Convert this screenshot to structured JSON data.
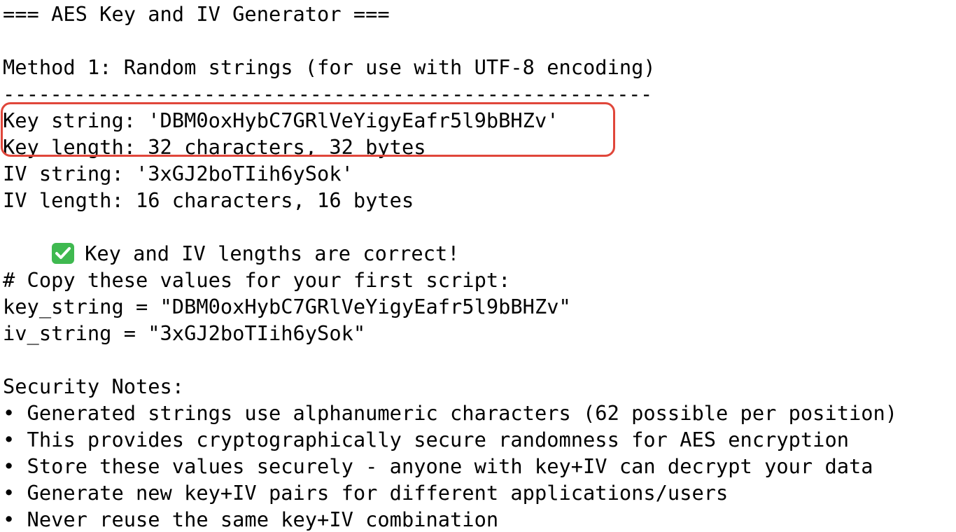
{
  "header": {
    "title": "=== AES Key and IV Generator ==="
  },
  "method1": {
    "heading": "Method 1: Random strings (for use with UTF-8 encoding)",
    "separator": "-------------------------------------------------------"
  },
  "key": {
    "string_line": "Key string: 'DBM0oxHybC7GRlVeYigyEafr5l9bBHZv'",
    "length_line": "Key length: 32 characters, 32 bytes"
  },
  "iv": {
    "string_line": "IV string: '3xGJ2boTIih6ySok'",
    "length_line": "IV length: 16 characters, 16 bytes"
  },
  "status": {
    "icon": "check-mark-icon",
    "icon_color": "#3fb950",
    "text": "Key and IV lengths are correct!"
  },
  "copy": {
    "comment": "# Copy these values for your first script:",
    "key_assign": "key_string = \"DBM0oxHybC7GRlVeYigyEafr5l9bBHZv\"",
    "iv_assign": "iv_string = \"3xGJ2boTIih6ySok\""
  },
  "security": {
    "heading": "Security Notes:",
    "notes": [
      "• Generated strings use alphanumeric characters (62 possible per position)",
      "• This provides cryptographically secure randomness for AES encryption",
      "• Store these values securely - anyone with key+IV can decrypt your data",
      "• Generate new key+IV pairs for different applications/users",
      "• Never reuse the same key+IV combination"
    ]
  },
  "highlight_color": "#e0463a"
}
